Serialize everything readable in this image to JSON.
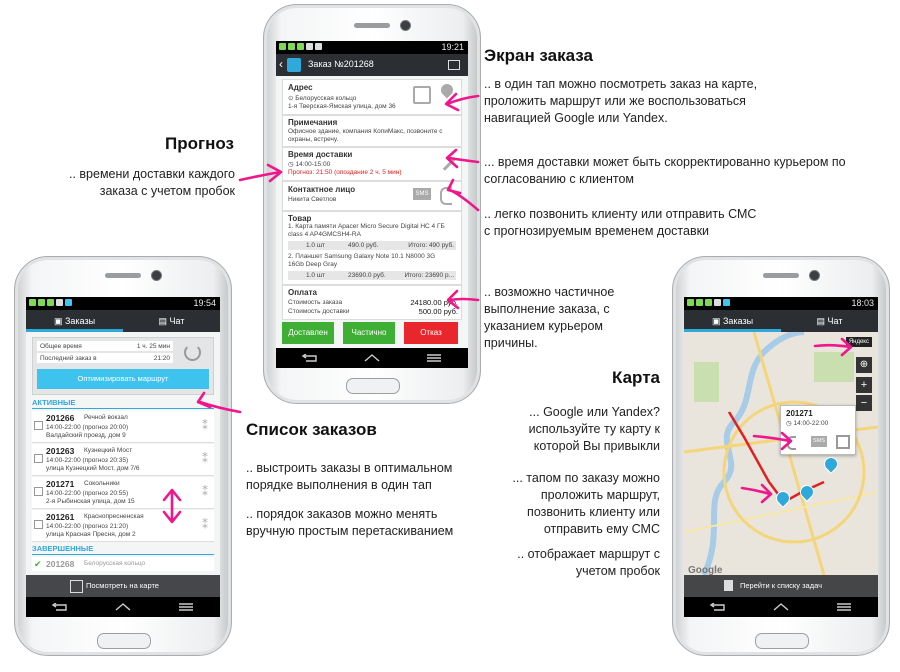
{
  "annotations": {
    "order_title": "Экран заказа",
    "order_map_note": ".. в один тап можно посмотреть заказ на карте, проложить маршрут или же воспользоваться навигацией Google или Yandex.",
    "order_time_note": "... время доставки может быть скорректированно курьером по согласованию с клиентом",
    "order_call_note": ".. легко позвонить клиенту или отправить СМС с прогнозируемым временем доставки",
    "order_partial_note": ".. возможно частичное выполнение заказа, с указанием курьером причины.",
    "forecast_title": "Прогноз",
    "forecast_note": ".. времени доставки каждого заказа с учетом пробок",
    "list_title": "Список заказов",
    "list_opt_note": ".. выстроить заказы в оптимальном порядке выполнения в один тап",
    "list_drag_note": ".. порядок заказов можно менять вручную простым перетаскиванием",
    "map_title": "Карта",
    "map_provider_note": "... Google или Yandex? используйте ту карту к которой Вы привыкли",
    "map_tap_note": "... тапом по заказу можно проложить маршрут, позвонить клиенту или отправить ему СМС",
    "map_route_note": ".. отображает маршрут с учетом пробок"
  },
  "order_phone": {
    "time": "19:21",
    "title": "Заказ №201268",
    "address": {
      "label": "Адрес",
      "metro": "Белорусская кольцо",
      "street": "1-я Тверская-Ямская улица, дом 36"
    },
    "notes": {
      "label": "Примечания",
      "text": "Офисное здание, компания КопиМакс, позвоните с охраны, встречу."
    },
    "delivery": {
      "label": "Время доставки",
      "window": "14:00-15:00",
      "forecast": "Прогноз: 21:50 (опоздание 2 ч. 5 мин)"
    },
    "contact": {
      "label": "Контактное лицо",
      "name": "Никита Светлов",
      "sms": "SMS"
    },
    "goods": {
      "label": "Товар",
      "items": [
        {
          "name": "1. Карта памяти Apacer Micro Secure Digital HC 4 ГБ class 4 AP4GMCSH4-RA",
          "qty": "1.0 шт",
          "price": "490.0 руб.",
          "total": "Итого: 490 руб."
        },
        {
          "name": "2. Планшет Samsung Galaxy Note 10.1 N8000 3G 16Gb Deep Gray",
          "qty": "1.0 шт",
          "price": "23690.0 руб.",
          "total": "Итого: 23690 р..."
        }
      ]
    },
    "payment": {
      "label": "Оплата",
      "order_cost_label": "Стоимость заказа",
      "order_cost": "24180.00 руб.",
      "delivery_cost_label": "Стоимость доставки",
      "delivery_cost": "500.00 руб."
    },
    "buttons": {
      "delivered": "Доставлен",
      "partial": "Частично",
      "refused": "Отказ"
    },
    "colors": {
      "delivered": "#3fae34",
      "partial": "#3fae34",
      "refused": "#e8262c"
    }
  },
  "list_phone": {
    "time": "19:54",
    "tabs": {
      "orders": "Заказы",
      "chat": "Чат"
    },
    "summary": {
      "total_label": "Общее время",
      "total_value": "1 ч. 25 мин",
      "last_label": "Последний заказ в",
      "last_value": "21:20"
    },
    "optimize_label": "Оптимизировать маршрут",
    "active_label": "АКТИВНЫЕ",
    "done_label": "ЗАВЕРШЕННЫЕ",
    "orders": [
      {
        "id": "201266",
        "metro": "Речной вокзал",
        "time": "14:00-22:00 (прогноз 20:00)",
        "addr": "Валдайский проезд, дом 9"
      },
      {
        "id": "201263",
        "metro": "Кузнецкий Мост",
        "time": "14:00-22:00 (прогноз 20:35)",
        "addr": "улица Кузнецкий Мост, дом 7/6"
      },
      {
        "id": "201271",
        "metro": "Сокольники",
        "time": "14:00-22:00 (прогноз 20:55)",
        "addr": "2-я Рыбинская улица, дом 15"
      },
      {
        "id": "201261",
        "metro": "Краснопресненская",
        "time": "14:00-22:00 (прогноз 21:20)",
        "addr": "улица Красная Пресня, дом 2"
      }
    ],
    "done_orders": [
      {
        "id": "201268",
        "metro": "Белорусская кольцо"
      }
    ],
    "map_button": "Посмотреть на карте"
  },
  "map_phone": {
    "time": "18:03",
    "tabs": {
      "orders": "Заказы",
      "chat": "Чат"
    },
    "popup": {
      "id": "201271",
      "time": "14:00-22:00",
      "sms": "SMS"
    },
    "yandex_badge": "Яндекс",
    "google_logo": "Google",
    "list_button": "Перейти к списку задач"
  }
}
